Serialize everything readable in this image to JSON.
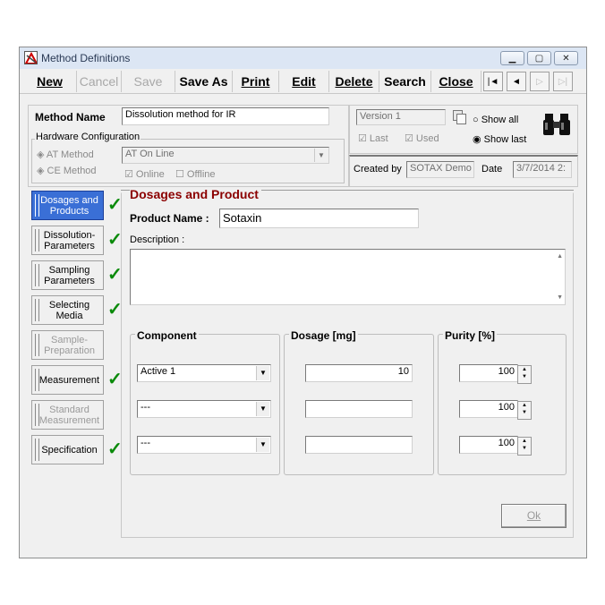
{
  "window": {
    "title": "Method Definitions"
  },
  "toolbar": {
    "new": "New",
    "cancel": "Cancel",
    "save": "Save",
    "save_as": "Save As",
    "print": "Print",
    "edit": "Edit",
    "delete": "Delete",
    "search": "Search",
    "close": "Close",
    "nav_first": "|◄",
    "nav_prev": "◄",
    "nav_next": "▷",
    "nav_last": "▷|"
  },
  "header": {
    "method_name_label": "Method Name",
    "method_name_value": "Dissolution method for IR",
    "hw_group_label": "Hardware Configuration",
    "at_method_label": "AT Method",
    "ce_method_label": "CE Method",
    "at_combo_value": "AT On Line",
    "online_label": "Online",
    "offline_label": "Offline",
    "version_value": "Version 1",
    "last_label": "Last",
    "used_label": "Used",
    "show_all_label": "Show all",
    "show_last_label": "Show last",
    "created_by_label": "Created by",
    "created_by_value": "SOTAX Demo",
    "date_label": "Date",
    "date_value": "3/7/2014 2:"
  },
  "sidebar": {
    "items": [
      {
        "label": "Dosages and Products",
        "checked": true,
        "state": "active"
      },
      {
        "label": "Dissolution-Parameters",
        "checked": true,
        "state": "normal"
      },
      {
        "label": "Sampling Parameters",
        "checked": true,
        "state": "normal"
      },
      {
        "label": "Selecting Media",
        "checked": true,
        "state": "normal"
      },
      {
        "label": "Sample-Preparation",
        "checked": false,
        "state": "disabled"
      },
      {
        "label": "Measurement",
        "checked": true,
        "state": "normal"
      },
      {
        "label": "Standard Measurement",
        "checked": false,
        "state": "disabled"
      },
      {
        "label": "Specification",
        "checked": true,
        "state": "normal"
      }
    ]
  },
  "main": {
    "section_title": "Dosages and Product",
    "product_name_label": "Product Name :",
    "product_name_value": "Sotaxin",
    "description_label": "Description :",
    "description_value": "",
    "component_header": "Component",
    "dosage_header": "Dosage [mg]",
    "purity_header": "Purity [%]",
    "rows": [
      {
        "component": "Active 1",
        "dosage": "10",
        "purity": "100"
      },
      {
        "component": "---",
        "dosage": "",
        "purity": "100"
      },
      {
        "component": "---",
        "dosage": "",
        "purity": "100"
      }
    ],
    "ok_label": "Ok"
  },
  "colors": {
    "section_title": "#8b0000",
    "check": "#0a8a0a",
    "active_tab": "#3a6fd6"
  }
}
